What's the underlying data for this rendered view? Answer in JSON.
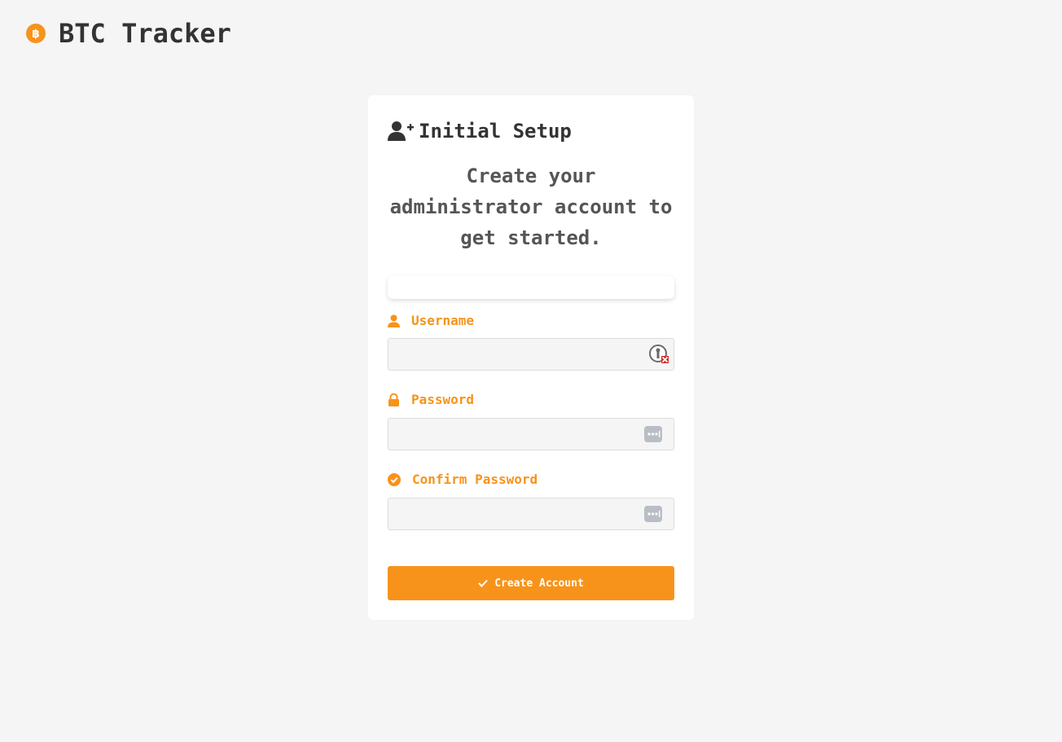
{
  "app": {
    "title": "BTC Tracker",
    "accent_color": "#f7931a",
    "logo_icon": "bitcoin-icon"
  },
  "setup_card": {
    "title": "Initial Setup",
    "title_icon": "user-plus-icon",
    "subtitle": "Create your administrator account to get started.",
    "fields": {
      "username": {
        "label": "Username",
        "icon": "user-icon",
        "value": "",
        "placeholder": "",
        "adornment_icon": "password-manager-blocked-icon"
      },
      "password": {
        "label": "Password",
        "icon": "lock-icon",
        "value": "",
        "placeholder": "",
        "adornment_icon": "password-dots-icon"
      },
      "confirm_password": {
        "label": "Confirm Password",
        "icon": "check-circle-icon",
        "value": "",
        "placeholder": "",
        "adornment_icon": "password-dots-icon"
      }
    },
    "submit_button": {
      "label": "Create Account",
      "icon": "check-icon"
    }
  }
}
